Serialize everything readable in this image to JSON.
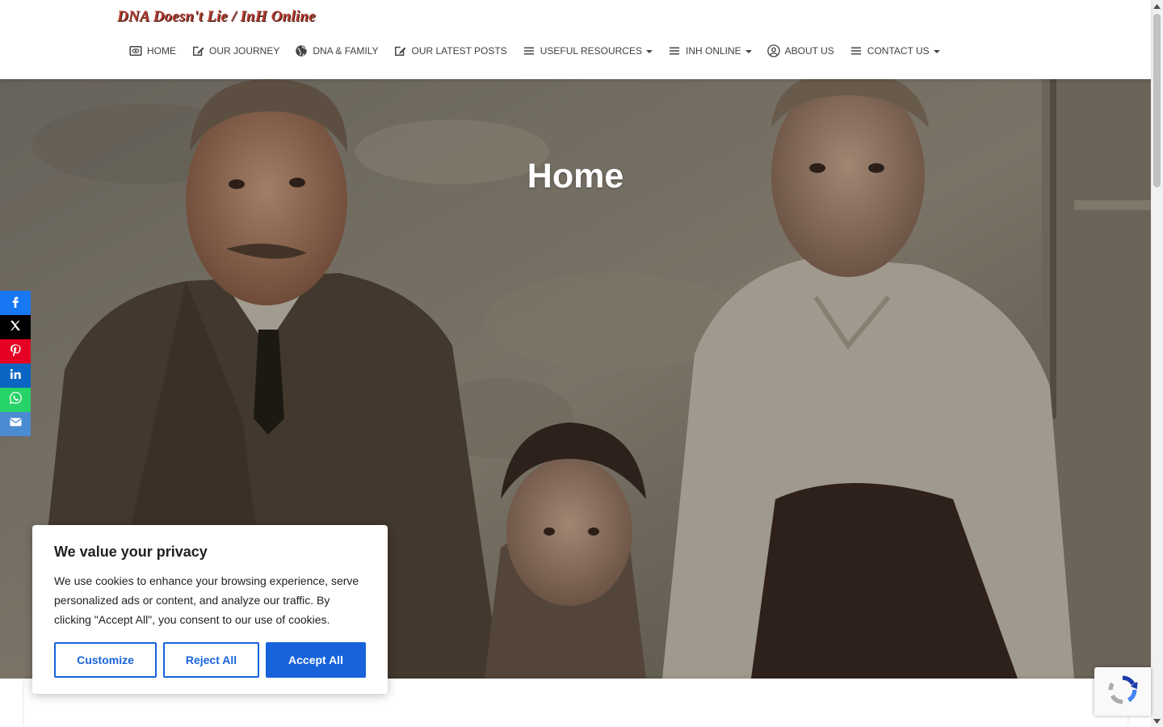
{
  "header": {
    "brand": "DNA Doesn't Lie / InH Online",
    "nav": [
      {
        "label": "HOME",
        "icon": "eye-card-icon",
        "has_caret": false
      },
      {
        "label": "OUR JOURNEY",
        "icon": "edit-note-icon",
        "has_caret": false
      },
      {
        "label": "DNA & FAMILY",
        "icon": "globe-icon",
        "has_caret": false
      },
      {
        "label": "OUR LATEST POSTS",
        "icon": "edit-note-icon",
        "has_caret": false
      },
      {
        "label": "USEFUL RESOURCES",
        "icon": "menu-lines-icon",
        "has_caret": true
      },
      {
        "label": "INH ONLINE",
        "icon": "menu-lines-icon",
        "has_caret": true
      },
      {
        "label": "ABOUT US",
        "icon": "user-circle-icon",
        "has_caret": false
      },
      {
        "label": "CONTACT US",
        "icon": "menu-lines-icon",
        "has_caret": true
      }
    ]
  },
  "hero": {
    "title": "Home"
  },
  "social": [
    {
      "name": "facebook",
      "icon": "facebook-icon",
      "color": "#1877f2"
    },
    {
      "name": "x",
      "icon": "x-icon",
      "color": "#000000"
    },
    {
      "name": "pinterest",
      "icon": "pinterest-icon",
      "color": "#e60023"
    },
    {
      "name": "linkedin",
      "icon": "linkedin-icon",
      "color": "#0a66c2"
    },
    {
      "name": "whatsapp",
      "icon": "whatsapp-icon",
      "color": "#25d366"
    },
    {
      "name": "email",
      "icon": "mail-icon",
      "color": "#4b8bd1"
    }
  ],
  "cookie": {
    "title": "We value your privacy",
    "text": "We use cookies to enhance your browsing experience, serve personalized ads or content, and analyze our traffic. By clicking \"Accept All\", you consent to our use of cookies.",
    "customize": "Customize",
    "reject": "Reject All",
    "accept": "Accept All",
    "accent": "#1863dc"
  }
}
